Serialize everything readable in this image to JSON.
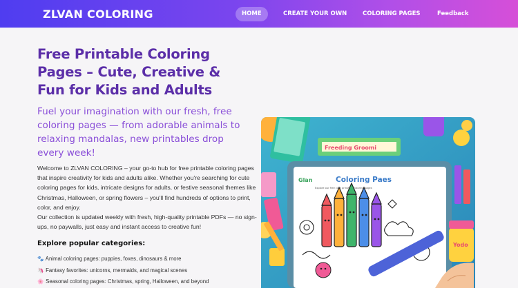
{
  "nav": {
    "brand": "ZLVAN COLORING",
    "links": [
      "HOME",
      "CREATE YOUR OWN",
      "COLORING PAGES",
      "Feedback"
    ]
  },
  "hero": {
    "title": "Free Printable Coloring Pages – Cute, Creative & Fun for Kids and Adults",
    "subtitle": "Fuel your imagination with our fresh, free coloring pages — from adorable animals to relaxing mandalas, new printables drop every week!",
    "intro_p1": "Welcome to ZLVAN COLORING – your go-to hub for free printable coloring pages that inspire creativity for kids and adults alike. Whether you're searching for cute coloring pages for kids, intricate designs for adults, or festive seasonal themes like Christmas, Halloween, or spring flowers – you'll find hundreds of options to print, color, and enjoy.",
    "intro_p2": "Our collection is updated weekly with fresh, high-quality printable PDFs — no sign-ups, no paywalls, just easy and instant access to creative fun!"
  },
  "categories": {
    "heading": "Explore popular categories:",
    "items": [
      {
        "icon": "paw-icon",
        "text": "Animal coloring pages: puppies, foxes, dinosaurs & more"
      },
      {
        "icon": "unicorn-icon",
        "text": "Fantasy favorites: unicorns, mermaids, and magical scenes"
      },
      {
        "icon": "flower-icon",
        "text": "Seasonal coloring pages: Christmas, spring, Halloween, and beyond"
      }
    ]
  },
  "illustration": {
    "box_text": "Freeding Groomi",
    "tablet_title": "Coloring Paes",
    "tablet_logo": "Glan",
    "tablet_caption": "Explore our free cute printable coloring pages",
    "jar_label": "Yodo"
  },
  "colors": {
    "nav_start": "#4f3df0",
    "nav_end": "#d64fd8",
    "title": "#5b2ea8",
    "subtitle": "#8a4fd8",
    "bg": "#f6f5f7"
  }
}
